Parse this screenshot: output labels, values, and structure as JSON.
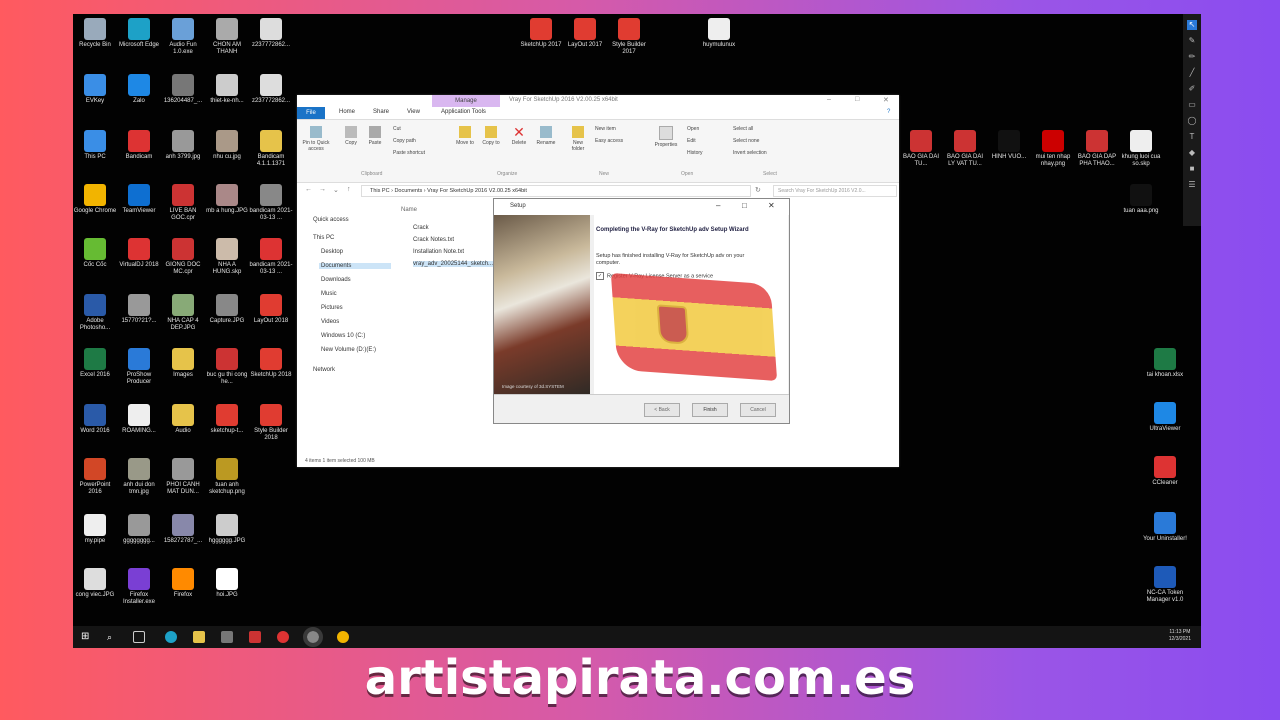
{
  "brand": {
    "text": "artistapirata.com.es"
  },
  "desktop_icons": [
    {
      "label": "Recycle Bin",
      "color": "#9ab"
    },
    {
      "label": "Microsoft Edge",
      "color": "#1da1c7"
    },
    {
      "label": "Audio Fun 1.0.exe",
      "color": "#6aa0d8"
    },
    {
      "label": "CHON AM THANH",
      "color": "#aaa"
    },
    {
      "label": "z237772862...",
      "color": "#ddd"
    },
    {
      "label": "SketchUp 2017",
      "color": "#e03c31"
    },
    {
      "label": "LayOut 2017",
      "color": "#e03c31"
    },
    {
      "label": "Style Builder 2017",
      "color": "#e03c31"
    },
    {
      "label": "huymulunux",
      "color": "#eee"
    },
    {
      "label": "EVKey",
      "color": "#3a8ee6"
    },
    {
      "label": "Zalo",
      "color": "#1e88e5"
    },
    {
      "label": "136204487_...",
      "color": "#777"
    },
    {
      "label": "thiet-ke-nh...",
      "color": "#ccc"
    },
    {
      "label": "z237772862...",
      "color": "#ddd"
    },
    {
      "label": "This PC",
      "color": "#3a8ee6"
    },
    {
      "label": "Bandicam",
      "color": "#d33"
    },
    {
      "label": "anh 3799.jpg",
      "color": "#999"
    },
    {
      "label": "nhu cu.jpg",
      "color": "#a98"
    },
    {
      "label": "Bandicam 4.1.1.1371",
      "color": "#e6c34a"
    },
    {
      "label": "Google Chrome",
      "color": "#f2b400"
    },
    {
      "label": "TeamViewer",
      "color": "#0e6fd1"
    },
    {
      "label": "LIVE BAN GOC.cpr",
      "color": "#c33"
    },
    {
      "label": "mb a hung.JPG",
      "color": "#a88"
    },
    {
      "label": "bandicam 2021-03-13 ...",
      "color": "#888"
    },
    {
      "label": "Cốc Cốc",
      "color": "#6b3"
    },
    {
      "label": "VirtualDJ 2018",
      "color": "#d33"
    },
    {
      "label": "GIONG DOC MC.cpr",
      "color": "#c33"
    },
    {
      "label": "NHA A HUNG.skp",
      "color": "#cba"
    },
    {
      "label": "bandicam 2021-03-13 ...",
      "color": "#d33"
    },
    {
      "label": "Adobe Photosho...",
      "color": "#2a5aa8"
    },
    {
      "label": "15770?21?...",
      "color": "#999"
    },
    {
      "label": "NHA CAP 4 DEP.JPG",
      "color": "#8a7"
    },
    {
      "label": "Capture.JPG",
      "color": "#888"
    },
    {
      "label": "LayOut 2018",
      "color": "#e03c31"
    },
    {
      "label": "Excel 2016",
      "color": "#1e7a45"
    },
    {
      "label": "ProShow Producer",
      "color": "#2a7ad8"
    },
    {
      "label": "Images",
      "color": "#e6c34a"
    },
    {
      "label": "buc gu thi cong he...",
      "color": "#c33"
    },
    {
      "label": "SketchUp 2018",
      "color": "#e03c31"
    },
    {
      "label": "Word 2016",
      "color": "#2a5aa8"
    },
    {
      "label": "ROAMING...",
      "color": "#eee"
    },
    {
      "label": "Audio",
      "color": "#e6c34a"
    },
    {
      "label": "sketchup-t...",
      "color": "#e03c31"
    },
    {
      "label": "Style Builder 2018",
      "color": "#e03c31"
    },
    {
      "label": "PowerPoint 2016",
      "color": "#d24726"
    },
    {
      "label": "anh dui don tmn.jpg",
      "color": "#998"
    },
    {
      "label": "PHOI CANH MAT DUN...",
      "color": "#999"
    },
    {
      "label": "tuan anh sketchup.png",
      "color": "#b92"
    },
    {
      "label": "my.pipe",
      "color": "#eee"
    },
    {
      "label": "gggggggg...",
      "color": "#999"
    },
    {
      "label": "158272787_...",
      "color": "#88a"
    },
    {
      "label": "hgggggg.JPG",
      "color": "#ccc"
    },
    {
      "label": "cong viec.JPG",
      "color": "#ddd"
    },
    {
      "label": "Firefox Installer.exe",
      "color": "#7a3fd4"
    },
    {
      "label": "Firefox",
      "color": "#ff8a00"
    },
    {
      "label": "hoi.JPG",
      "color": "#fff"
    },
    {
      "label": "BAO GIA DAI TU...",
      "color": "#c33"
    },
    {
      "label": "BAO GIA DAI LY VAT TU...",
      "color": "#c33"
    },
    {
      "label": "HINH VUO...",
      "color": "#111"
    },
    {
      "label": "mui ten nhap nhay.png",
      "color": "#c00"
    },
    {
      "label": "BAO GIA DAP PHA THAO...",
      "color": "#c33"
    },
    {
      "label": "khung luoi cua so.skp",
      "color": "#eee"
    },
    {
      "label": "tuan aaa.png",
      "color": "#111"
    },
    {
      "label": "tai khoan.xlsx",
      "color": "#1e7a45"
    },
    {
      "label": "UltraViewer",
      "color": "#1e88e5"
    },
    {
      "label": "CCleaner",
      "color": "#d33"
    },
    {
      "label": "Your Uninstaller!",
      "color": "#2a7ad8"
    },
    {
      "label": "NC-CA Token Manager v1.0",
      "color": "#1e5ab8"
    }
  ],
  "explorer": {
    "manage_tab": "Manage",
    "title": "Vray For SketchUp 2016 V2.00.25 x64bit",
    "tabs": [
      "File",
      "Home",
      "Share",
      "View",
      "Application Tools"
    ],
    "ribbon": {
      "pin": "Pin to Quick access",
      "copy": "Copy",
      "paste": "Paste",
      "cut": "Cut",
      "copy_path": "Copy path",
      "paste_shortcut": "Paste shortcut",
      "move_to": "Move to",
      "copy_to": "Copy to",
      "delete": "Delete",
      "rename": "Rename",
      "new_folder": "New folder",
      "new_item": "New item",
      "easy_access": "Easy access",
      "properties": "Properties",
      "open": "Open",
      "edit": "Edit",
      "history": "History",
      "select_all": "Select all",
      "select_none": "Select none",
      "invert_selection": "Invert selection",
      "sections": [
        "Clipboard",
        "Organize",
        "New",
        "Open",
        "Select"
      ]
    },
    "breadcrumb": "This PC  ›  Documents  ›  Vray For SketchUp 2016 V2.00.25 x64bit",
    "search_placeholder": "Search Vray For SketchUp 2016 V2.0...",
    "nav": [
      "Quick access",
      "This PC",
      "Desktop",
      "Documents",
      "Downloads",
      "Music",
      "Pictures",
      "Videos",
      "Windows 10 (C:)",
      "New Volume (D:)(E:)",
      "Network"
    ],
    "column_name": "Name",
    "files": [
      "Crack",
      "Crack Notes.txt",
      "Installation Note.txt",
      "vray_adv_20025144_sketch..."
    ],
    "status": "4 items     1 item selected  100 MB"
  },
  "setup": {
    "title": "Setup",
    "heading": "Completing the V-Ray for SketchUp adv Setup Wizard",
    "body": "Setup has finished installing V-Ray for SketchUp adv on your computer.",
    "checkbox": "Register V-Ray License Server as a service",
    "credit": "Image courtesy of 3d.SYSTEM",
    "back": "< Back",
    "finish": "Finish",
    "cancel": "Cancel"
  },
  "tray": {
    "time": "11:13 PM",
    "date": "12/3/2021"
  }
}
